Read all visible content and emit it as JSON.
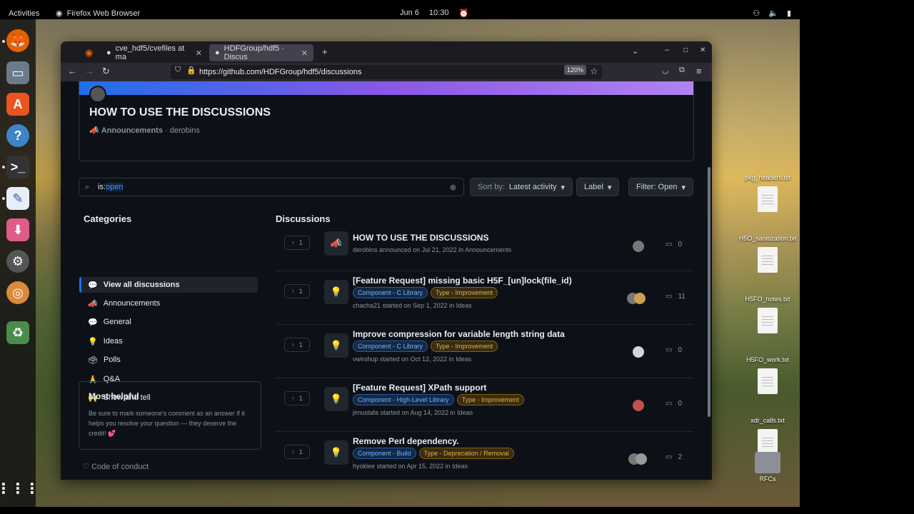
{
  "topbar": {
    "activities": "Activities",
    "app_name": "Firefox Web Browser",
    "date": "Jun 6",
    "time": "10:30"
  },
  "browser": {
    "tabs": [
      {
        "label": "cve_hdf5/cvefiles at ma"
      },
      {
        "label": "HDFGroup/hdf5 · Discus"
      }
    ],
    "url": "https://github.com/HDFGroup/hdf5/discussions",
    "zoom": "120%"
  },
  "announcement": {
    "title": "HOW TO USE THE DISCUSSIONS",
    "category": "Announcements",
    "author": "derobins"
  },
  "search": {
    "prefix": "is:",
    "value": "open"
  },
  "controls": {
    "sort_prefix": "Sort by:",
    "sort_value": "Latest activity",
    "label": "Label",
    "filter": "Filter: Open"
  },
  "categories": {
    "heading": "Categories",
    "items": [
      {
        "label": "View all discussions",
        "icon": "💬"
      },
      {
        "label": "Announcements",
        "icon": "📣"
      },
      {
        "label": "General",
        "icon": "💬"
      },
      {
        "label": "Ideas",
        "icon": "💡"
      },
      {
        "label": "Polls",
        "icon": "🗳"
      },
      {
        "label": "Q&A",
        "icon": "🙏"
      },
      {
        "label": "Show and tell",
        "icon": "🙌"
      }
    ]
  },
  "most_helpful": {
    "heading": "Most helpful",
    "text": "Be sure to mark someone's comment as an answer if it helps you resolve your question — they deserve the credit! 💕"
  },
  "code_of_conduct": "Code of conduct",
  "discussions": {
    "heading": "Discussions",
    "rows": [
      {
        "title": "HOW TO USE THE DISCUSSIONS",
        "meta": "derobins announced on Jul 21, 2022 in Announcements",
        "votes": "1",
        "comments": "0",
        "icon": "📣",
        "labels": []
      },
      {
        "title": "[Feature Request] missing basic H5F_[un]lock(file_id)",
        "meta": "chacha21 started on Sep 1, 2022 in Ideas",
        "votes": "1",
        "comments": "11",
        "icon": "💡",
        "labels": [
          {
            "text": "Component - C Library",
            "color": "blue"
          },
          {
            "text": "Type - Improvement",
            "color": "yellow"
          }
        ]
      },
      {
        "title": "Improve compression for variable length string data",
        "meta": "vwirshup started on Oct 12, 2022 in Ideas",
        "votes": "1",
        "comments": "0",
        "icon": "💡",
        "labels": [
          {
            "text": "Component - C Library",
            "color": "blue"
          },
          {
            "text": "Type - Improvement",
            "color": "yellow"
          }
        ]
      },
      {
        "title": "[Feature Request] XPath support",
        "meta": "jimustafa started on Aug 14, 2022 in Ideas",
        "votes": "1",
        "comments": "0",
        "icon": "💡",
        "labels": [
          {
            "text": "Component - High-Level Library",
            "color": "blue"
          },
          {
            "text": "Type - Improvement",
            "color": "yellow"
          }
        ]
      },
      {
        "title": "Remove Perl dependency.",
        "meta": "hyoklee started on Apr 15, 2022 in Ideas",
        "votes": "1",
        "comments": "2",
        "icon": "💡",
        "labels": [
          {
            "text": "Component - Build",
            "color": "blue"
          },
          {
            "text": "Type - Deprecation / Removal",
            "color": "yellow"
          }
        ]
      }
    ]
  },
  "desktop_files": [
    {
      "name": "pkg_headers.txt"
    },
    {
      "name": "H5O_sanitization.txt"
    },
    {
      "name": "H5FO_notes.txt"
    },
    {
      "name": "H5FO_work.txt"
    },
    {
      "name": "xdr_calls.txt"
    },
    {
      "name": "RFCs"
    }
  ]
}
